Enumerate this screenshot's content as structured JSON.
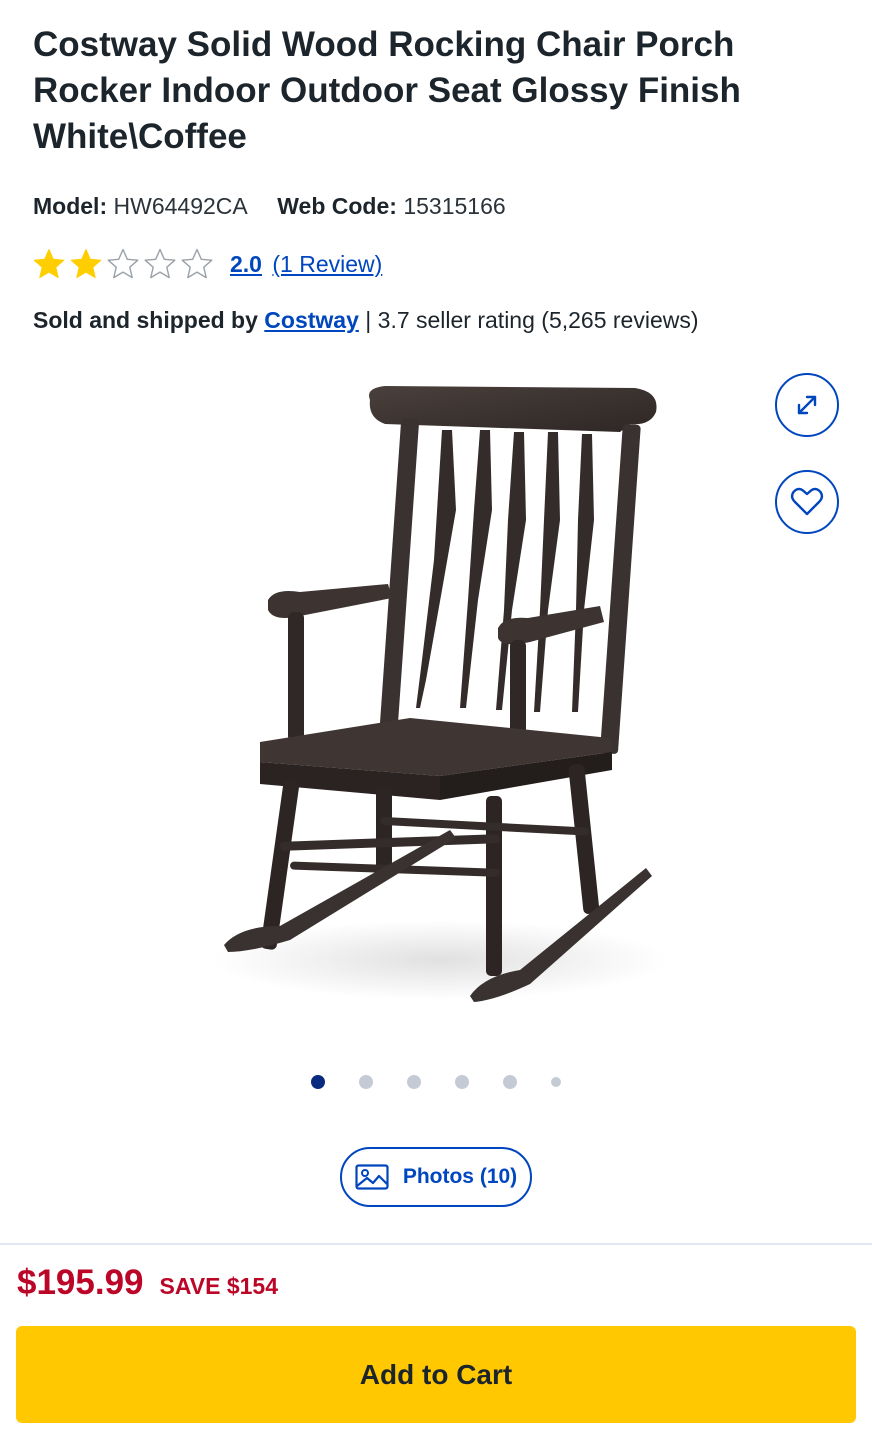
{
  "product": {
    "title": "Costway Solid Wood Rocking Chair Porch Rocker Indoor Outdoor Seat Glossy Finish White\\Coffee",
    "model_label": "Model:",
    "model_value": "HW64492CA",
    "webcode_label": "Web Code:",
    "webcode_value": "15315166"
  },
  "rating": {
    "stars_filled": 2,
    "stars_total": 5,
    "score": "2.0",
    "count_text": "(1 Review)"
  },
  "seller": {
    "prefix": "Sold and shipped by",
    "name": "Costway",
    "meta": "| 3.7 seller rating (5,265 reviews)"
  },
  "gallery": {
    "image_subject": "dark coffee rocking chair",
    "dots_total": 6,
    "active_dot": 0,
    "photos_button": "Photos (10)",
    "expand_icon": "expand-icon",
    "favorite_icon": "heart-icon"
  },
  "pricing": {
    "price": "$195.99",
    "save": "SAVE $154"
  },
  "actions": {
    "add_to_cart": "Add to Cart"
  },
  "colors": {
    "brand_blue": "#0046be",
    "price_red": "#bb0628",
    "cart_yellow": "#ffc800",
    "star_gold": "#ffce00"
  }
}
